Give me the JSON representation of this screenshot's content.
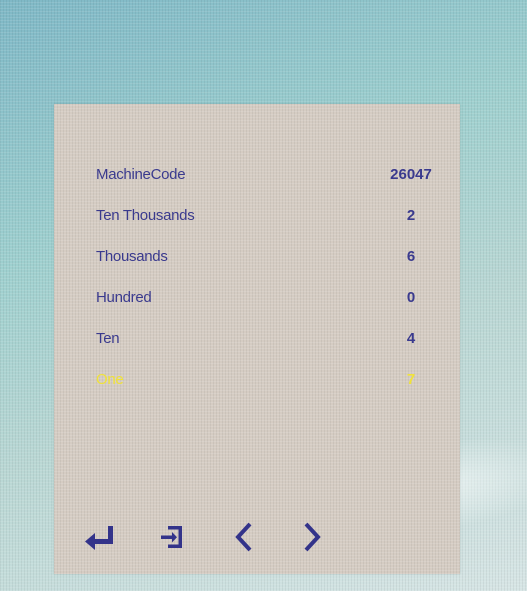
{
  "colors": {
    "panel_bg": "#d5ccc3",
    "text": "#3a3a8e",
    "selected_text": "#f0e23a"
  },
  "rows": [
    {
      "label": "MachineCode",
      "value": "26047"
    },
    {
      "label": "Ten Thousands",
      "value": "2"
    },
    {
      "label": "Thousands",
      "value": "6"
    },
    {
      "label": "Hundred",
      "value": "0"
    },
    {
      "label": "Ten",
      "value": "4"
    },
    {
      "label": "One",
      "value": "7",
      "selected": true
    }
  ],
  "toolbar": {
    "icons": [
      "enter-icon",
      "exit-icon",
      "left-arrow-icon",
      "right-arrow-icon"
    ]
  }
}
